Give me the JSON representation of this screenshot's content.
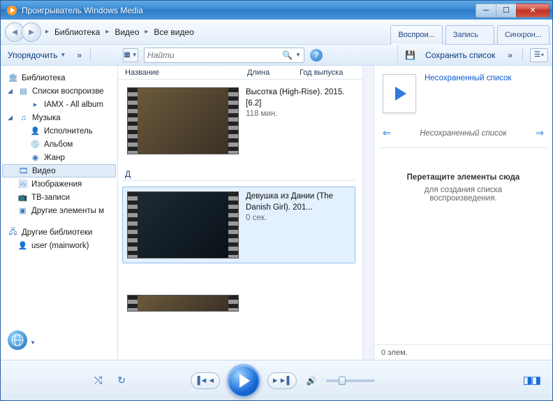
{
  "window": {
    "title": "Проигрыватель Windows Media"
  },
  "breadcrumb": {
    "library": "Библиотека",
    "video": "Видео",
    "allvideo": "Все видео"
  },
  "tabs": {
    "play": "Воспрои...",
    "burn": "Запись",
    "sync": "Синхрон..."
  },
  "toolbar": {
    "organize": "Упорядочить",
    "more": "»",
    "search_placeholder": "Найти",
    "save_list": "Сохранить список",
    "save_more": "»"
  },
  "columns": {
    "name": "Название",
    "length": "Длина",
    "year": "Год выпуска"
  },
  "tree": {
    "library": "Библиотека",
    "playlists": "Списки воспроизве",
    "playlist1": "IAMX - All album",
    "music": "Музыка",
    "artist": "Исполнитель",
    "album": "Альбом",
    "genre": "Жанр",
    "video": "Видео",
    "images": "Изображения",
    "tv": "ТВ-записи",
    "other": "Другие элементы м",
    "otherlibs": "Другие библиотеки",
    "user": "user (mainwork)"
  },
  "videos": {
    "0": {
      "title": "Высотка (High-Rise). 2015. [6.2]",
      "duration": "118 мин."
    },
    "group_d": "Д",
    "1": {
      "title": "Девушка из Дании (The Danish Girl). 201...",
      "duration": "0 сек."
    }
  },
  "rightpane": {
    "link": "Несохраненный список",
    "nav_caption": "Несохраненный список",
    "drop_title": "Перетащите элементы сюда",
    "drop_sub1": "для создания списка",
    "drop_sub2": "воспроизведения.",
    "footer": "0 элем."
  }
}
